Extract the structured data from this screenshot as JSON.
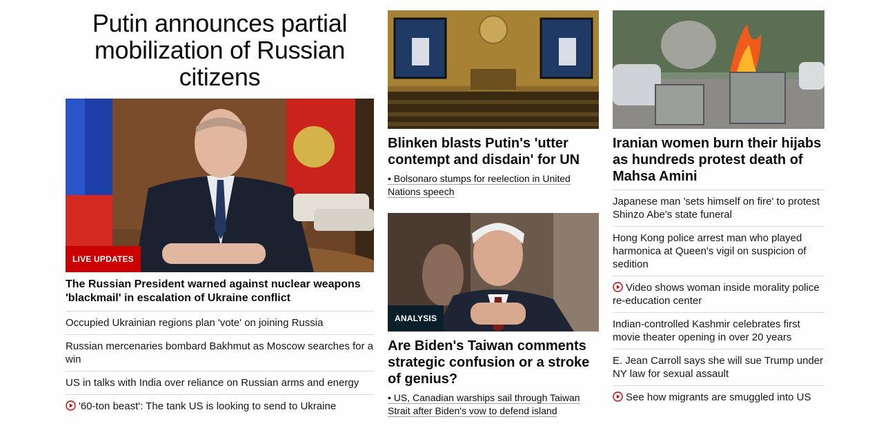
{
  "col1": {
    "title": "Putin announces partial mobilization of Russian citizens",
    "tag": "LIVE UPDATES",
    "lead": "The Russian President warned against nuclear weapons 'blackmail' in escalation of Ukraine conflict",
    "items": [
      "Occupied Ukrainian regions plan 'vote' on joining Russia",
      "Russian mercenaries bombard Bakhmut as Moscow searches for a win",
      "US in talks with India over reliance on Russian arms and energy",
      "'60-ton beast': The tank US is looking to send to Ukraine"
    ]
  },
  "col2": {
    "story1": {
      "headline": "Blinken blasts Putin's 'utter contempt and disdain' for UN",
      "sublink": "• Bolsonaro stumps for reelection in United Nations speech"
    },
    "story2": {
      "tag": "ANALYSIS",
      "headline": "Are Biden's Taiwan comments strategic confusion or a stroke of genius?",
      "sublink": "• US, Canadian warships sail through Taiwan Strait after Biden's vow to defend island"
    }
  },
  "col3": {
    "headline": "Iranian women burn their hijabs as hundreds protest death of Mahsa Amini",
    "items": [
      "Japanese man 'sets himself on fire' to protest Shinzo Abe's state funeral",
      "Hong Kong police arrest man who played harmonica at Queen's vigil on suspicion of sedition",
      "Video shows woman inside morality police re-education center",
      "Indian-controlled Kashmir celebrates first movie theater opening in over 20 years",
      "E. Jean Carroll says she will sue Trump under NY law for sexual assault",
      "See how migrants are smuggled into US"
    ]
  },
  "colors": {
    "accent": "#cc0000",
    "analysis": "#0b1f2a"
  }
}
